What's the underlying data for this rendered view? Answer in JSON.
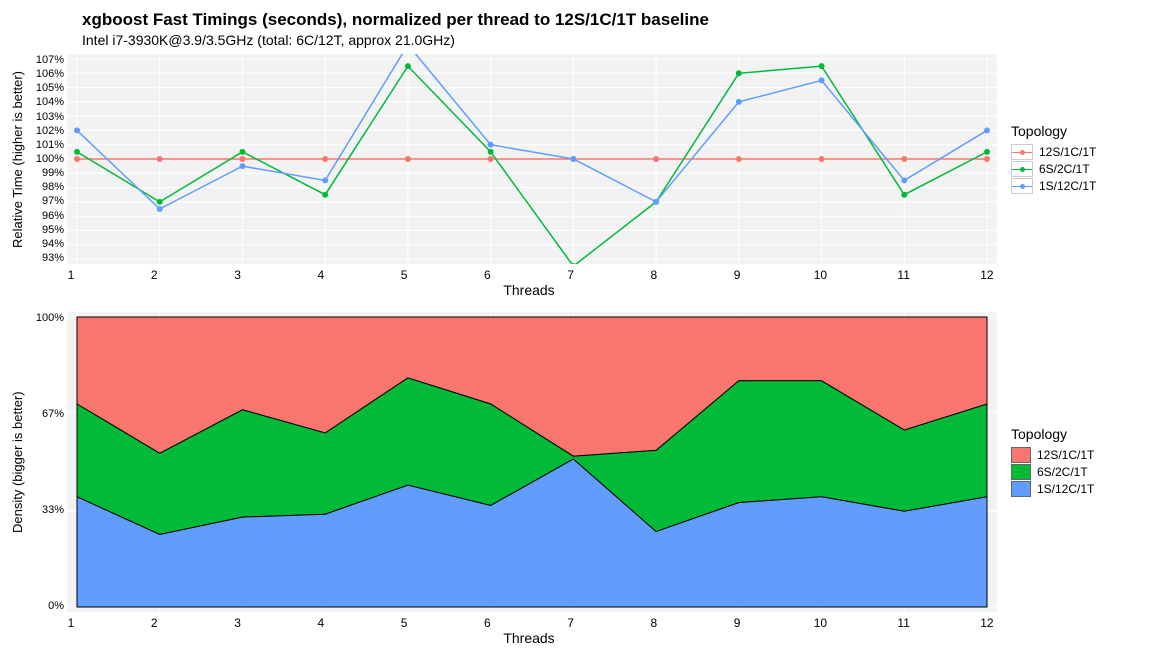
{
  "title": "xgboost Fast Timings (seconds), normalized per thread to 12S/1C/1T baseline",
  "subtitle": "Intel i7-3930K@3.9/3.5GHz (total: 6C/12T, approx 21.0GHz)",
  "legend_title": "Topology",
  "legend_items": [
    "12S/1C/1T",
    "6S/2C/1T",
    "1S/12C/1T"
  ],
  "top": {
    "ylabel": "Relative Time (higher is better)",
    "xlabel": "Threads",
    "yticks": [
      "107%",
      "106%",
      "105%",
      "104%",
      "103%",
      "102%",
      "101%",
      "100%",
      "99%",
      "98%",
      "97%",
      "96%",
      "95%",
      "94%",
      "93%"
    ],
    "ymin": 93,
    "ymax": 107
  },
  "bottom": {
    "ylabel": "Density (bigger is better)",
    "xlabel": "Threads",
    "yticks": [
      "100%",
      "67%",
      "33%",
      "0%"
    ],
    "ymin": 0,
    "ymax": 100
  },
  "xticks": [
    "1",
    "2",
    "3",
    "4",
    "5",
    "6",
    "7",
    "8",
    "9",
    "10",
    "11",
    "12"
  ],
  "chart_data": [
    {
      "type": "line",
      "title": "Relative Time vs Threads",
      "xlabel": "Threads",
      "ylabel": "Relative Time (higher is better)",
      "x": [
        1,
        2,
        3,
        4,
        5,
        6,
        7,
        8,
        9,
        10,
        11,
        12
      ],
      "ylim": [
        93,
        107
      ],
      "series": [
        {
          "name": "12S/1C/1T",
          "color": "#f8766d",
          "values": [
            100,
            100,
            100,
            100,
            100,
            100,
            100,
            100,
            100,
            100,
            100,
            100
          ]
        },
        {
          "name": "6S/2C/1T",
          "color": "#00ba38",
          "values": [
            100.5,
            97,
            100.5,
            97.5,
            106.5,
            100.5,
            92.5,
            97,
            106,
            106.5,
            97.5,
            100.5
          ]
        },
        {
          "name": "1S/12C/1T",
          "color": "#619cff",
          "values": [
            102,
            96.5,
            99.5,
            98.5,
            108,
            101,
            100,
            97,
            104,
            105.5,
            98.5,
            102
          ]
        }
      ]
    },
    {
      "type": "area",
      "stacked_to_100": true,
      "title": "Density vs Threads",
      "xlabel": "Threads",
      "ylabel": "Density (bigger is better)",
      "x": [
        1,
        2,
        3,
        4,
        5,
        6,
        7,
        8,
        9,
        10,
        11,
        12
      ],
      "ylim": [
        0,
        100
      ],
      "series_order_bottom_to_top": [
        "1S/12C/1T",
        "6S/2C/1T",
        "12S/1C/1T"
      ],
      "series": [
        {
          "name": "1S/12C/1T",
          "color": "#619cff",
          "values": [
            38,
            25,
            31,
            32,
            42,
            35,
            51,
            26,
            36,
            38,
            33,
            38
          ]
        },
        {
          "name": "6S/2C/1T",
          "color": "#00ba38",
          "values": [
            32,
            28,
            37,
            28,
            37,
            35,
            1,
            28,
            42,
            40,
            28,
            32
          ]
        },
        {
          "name": "12S/1C/1T",
          "color": "#f8766d",
          "values": [
            30,
            47,
            32,
            40,
            21,
            30,
            48,
            46,
            22,
            22,
            39,
            30
          ]
        }
      ],
      "cumulative_tops": {
        "1S/12C/1T": [
          38,
          25,
          31,
          32,
          42,
          35,
          51,
          26,
          36,
          38,
          33,
          38
        ],
        "6S/2C/1T": [
          70,
          53,
          68,
          60,
          79,
          70,
          52,
          54,
          78,
          78,
          61,
          70
        ]
      }
    }
  ]
}
